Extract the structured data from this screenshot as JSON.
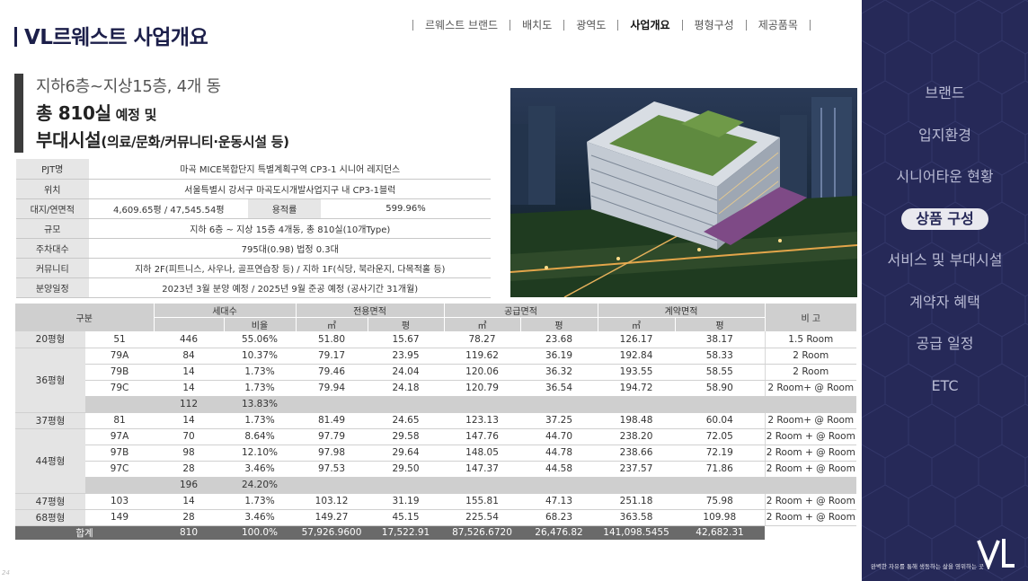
{
  "header": {
    "title": "VL르웨스트 사업개요",
    "nav": [
      {
        "label": "르웨스트 브랜드",
        "active": false
      },
      {
        "label": "배치도",
        "active": false
      },
      {
        "label": "광역도",
        "active": false
      },
      {
        "label": "사업개요",
        "active": true
      },
      {
        "label": "평형구성",
        "active": false
      },
      {
        "label": "제공품목",
        "active": false
      }
    ]
  },
  "headline": {
    "line1": "지하6층~지상15층, 4개 동",
    "line2_main": "총 810실",
    "line2_sub": " 예정 및",
    "line3_main": "부대시설",
    "line3_sub": "(의료/문화/커뮤니티·운동시설 등)"
  },
  "info": {
    "pjt_label": "PJT명",
    "pjt_value": "마곡 MICE복합단지 특별계획구역 CP3-1 시니어 레지던스",
    "loc_label": "위치",
    "loc_value": "서울특별시 강서구 마곡도시개발사업지구 내 CP3-1블럭",
    "area_label": "대지/연면적",
    "area_value": "4,609.65평 / 47,545.54평",
    "far_label": "용적률",
    "far_value": "599.96%",
    "scale_label": "규모",
    "scale_value": "지하 6층 ~ 지상 15층 4개동, 총 810실(10개Type)",
    "parking_label": "주차대수",
    "parking_value": "795대(0.98) 법정 0.3대",
    "comm_label": "커뮤니티",
    "comm_value": "지하 2F(피트니스, 사우나, 골프연습장 등) / 지하 1F(식당, 북라운지, 다목적홀 등)",
    "sale_label": "분양일정",
    "sale_value": "2023년 3월 분양 예정 / 2025년 9월 준공 예정 (공사기간 31개월)"
  },
  "units": {
    "headers": {
      "gubun": "구분",
      "households": "세대수",
      "ratio": "비율",
      "exclusive": "전용면적",
      "supply": "공급면적",
      "contract": "계약면적",
      "m2": "㎡",
      "pyeong": "평",
      "note": "비 고"
    },
    "rows": {
      "r20": {
        "group": "20평형",
        "type": "51",
        "count": "446",
        "ratio": "55.06%",
        "ex_m2": "51.80",
        "ex_py": "15.67",
        "su_m2": "78.27",
        "su_py": "23.68",
        "co_m2": "126.17",
        "co_py": "38.17",
        "note": "1.5 Room"
      },
      "r79a": {
        "group": "36평형",
        "type": "79A",
        "count": "84",
        "ratio": "10.37%",
        "ex_m2": "79.17",
        "ex_py": "23.95",
        "su_m2": "119.62",
        "su_py": "36.19",
        "co_m2": "192.84",
        "co_py": "58.33",
        "note": "2 Room"
      },
      "r79b": {
        "type": "79B",
        "count": "14",
        "ratio": "1.73%",
        "ex_m2": "79.46",
        "ex_py": "24.04",
        "su_m2": "120.06",
        "su_py": "36.32",
        "co_m2": "193.55",
        "co_py": "58.55",
        "note": "2 Room"
      },
      "r79c": {
        "type": "79C",
        "count": "14",
        "ratio": "1.73%",
        "ex_m2": "79.94",
        "ex_py": "24.18",
        "su_m2": "120.79",
        "su_py": "36.54",
        "co_m2": "194.72",
        "co_py": "58.90",
        "note": "2 Room+ @ Room"
      },
      "s36": {
        "count": "112",
        "ratio": "13.83%"
      },
      "r37": {
        "group": "37평형",
        "type": "81",
        "count": "14",
        "ratio": "1.73%",
        "ex_m2": "81.49",
        "ex_py": "24.65",
        "su_m2": "123.13",
        "su_py": "37.25",
        "co_m2": "198.48",
        "co_py": "60.04",
        "note": "2 Room+ @ Room"
      },
      "r97a": {
        "group": "44평형",
        "type": "97A",
        "count": "70",
        "ratio": "8.64%",
        "ex_m2": "97.79",
        "ex_py": "29.58",
        "su_m2": "147.76",
        "su_py": "44.70",
        "co_m2": "238.20",
        "co_py": "72.05",
        "note": "2 Room + @ Room"
      },
      "r97b": {
        "type": "97B",
        "count": "98",
        "ratio": "12.10%",
        "ex_m2": "97.98",
        "ex_py": "29.64",
        "su_m2": "148.05",
        "su_py": "44.78",
        "co_m2": "238.66",
        "co_py": "72.19",
        "note": "2 Room + @ Room"
      },
      "r97c": {
        "type": "97C",
        "count": "28",
        "ratio": "3.46%",
        "ex_m2": "97.53",
        "ex_py": "29.50",
        "su_m2": "147.37",
        "su_py": "44.58",
        "co_m2": "237.57",
        "co_py": "71.86",
        "note": "2 Room + @ Room"
      },
      "s44": {
        "count": "196",
        "ratio": "24.20%"
      },
      "r47": {
        "group": "47평형",
        "type": "103",
        "count": "14",
        "ratio": "1.73%",
        "ex_m2": "103.12",
        "ex_py": "31.19",
        "su_m2": "155.81",
        "su_py": "47.13",
        "co_m2": "251.18",
        "co_py": "75.98",
        "note": "2 Room + @ Room"
      },
      "r68": {
        "group": "68평형",
        "type": "149",
        "count": "28",
        "ratio": "3.46%",
        "ex_m2": "149.27",
        "ex_py": "45.15",
        "su_m2": "225.54",
        "su_py": "68.23",
        "co_m2": "363.58",
        "co_py": "109.98",
        "note": "2 Room + @ Room"
      }
    },
    "total": {
      "label": "합계",
      "count": "810",
      "ratio": "100.0%",
      "ex_m2": "57,926.9600",
      "ex_py": "17,522.91",
      "su_m2": "87,526.6720",
      "su_py": "26,476.82",
      "co_m2": "141,098.5455",
      "co_py": "42,682.31"
    }
  },
  "page_number": "24",
  "sidebar": {
    "items": [
      {
        "label": "브랜드",
        "active": false
      },
      {
        "label": "입지환경",
        "active": false
      },
      {
        "label": "시니어타운 현황",
        "active": false
      },
      {
        "label": "상품 구성",
        "active": true
      },
      {
        "label": "서비스 및 부대시설",
        "active": false
      },
      {
        "label": "계약자 혜택",
        "active": false
      },
      {
        "label": "공급 일정",
        "active": false
      },
      {
        "label": "ETC",
        "active": false
      }
    ],
    "tagline": "완벽한 자유를 통해 생동하는 삶을 영위하는 곳"
  },
  "colors": {
    "sidebar_bg": "#262958",
    "title": "#1c1f4a",
    "header_gray": "#cfcfcf",
    "total_bg": "#6a6a6a"
  }
}
